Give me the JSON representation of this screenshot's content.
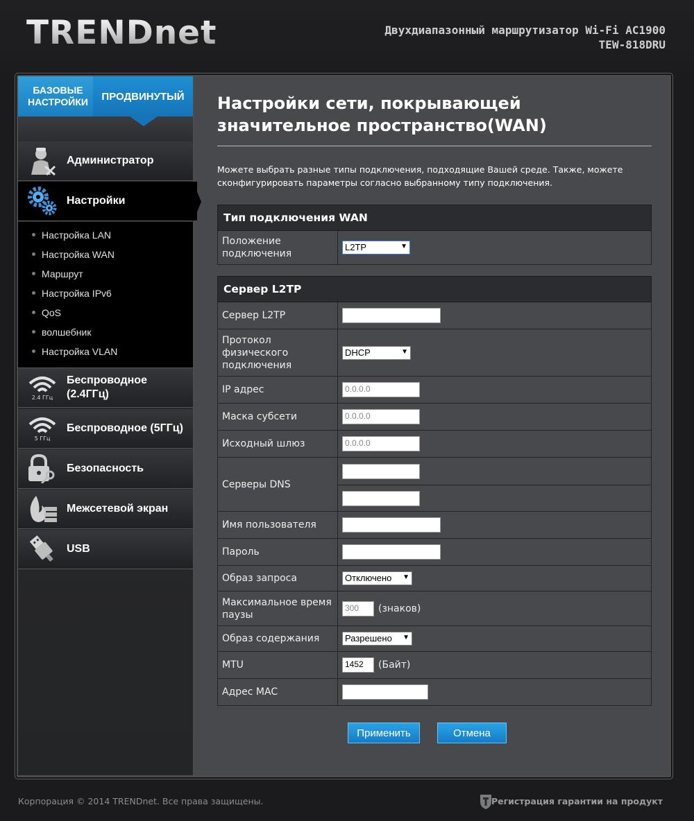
{
  "header": {
    "logo": "TRENDnet",
    "product_line1": "Двухдиапазонный маршрутизатор Wi-Fi AC1900",
    "product_line2": "TEW-818DRU"
  },
  "mode_tabs": {
    "basic": "БАЗОВЫЕ НАСТРОЙКИ",
    "advanced": "ПРОДВИНУТЫЙ",
    "active": "advanced"
  },
  "sidebar": {
    "items": [
      {
        "label": "Администратор",
        "icon": "admin-icon"
      },
      {
        "label": "Настройки",
        "icon": "gears-icon",
        "active": true
      },
      {
        "label": "Беспроводное (2.4ГГц)",
        "icon": "wifi-2-4-icon",
        "badge": "2.4 ГГц"
      },
      {
        "label": "Беспроводное (5ГГц)",
        "icon": "wifi-5-icon",
        "badge": "5 ГГц"
      },
      {
        "label": "Безопасность",
        "icon": "lock-icon"
      },
      {
        "label": "Межсетевой экран",
        "icon": "firewall-icon"
      },
      {
        "label": "USB",
        "icon": "usb-icon"
      }
    ],
    "submenu": [
      "Настройка LAN",
      "Настройка WAN",
      "Маршрут",
      "Настройка IPv6",
      "QoS",
      "волшебник",
      "Настройка VLAN"
    ]
  },
  "main": {
    "title": "Настройки сети, покрывающей значительное пространство(WAN)",
    "description": "Можете выбрать разные типы подключения, подходящие Вашей среде. Также, можете сконфигурировать параметры согласно выбранному типу подключения.",
    "wan_section": {
      "heading": "Тип подключения WAN",
      "connection_label": "Положение подключения",
      "connection_value": "L2TP"
    },
    "l2tp_section": {
      "heading": "Сервер L2TP",
      "server_label": "Сервер L2TP",
      "server_value": "",
      "phys_label": "Протокол физического подключения",
      "phys_value": "DHCP",
      "ip_label": "IP адрес",
      "ip_value": "0.0.0.0",
      "mask_label": "Маска субсети",
      "mask_value": "0.0.0.0",
      "gateway_label": "Исходный шлюз",
      "gateway_value": "0.0.0.0",
      "dns_label": "Серверы DNS",
      "dns1_value": "",
      "dns2_value": "",
      "user_label": "Имя пользователя",
      "user_value": "",
      "pass_label": "Пароль",
      "pass_value": "",
      "request_label": "Образ запроса",
      "request_value": "Отключено",
      "idle_label": "Максимальное время паузы",
      "idle_value": "300",
      "idle_unit": "(знаков)",
      "keepalive_label": "Образ содержания",
      "keepalive_value": "Разрешено",
      "mtu_label": "MTU",
      "mtu_value": "1452",
      "mtu_unit": "(Байт)",
      "mac_label": "Адрес MAC",
      "mac_value": ""
    },
    "apply_button": "Применить",
    "cancel_button": "Отмена"
  },
  "footer": {
    "copyright": "Корпорация © 2014 TRENDnet. Все права защищены.",
    "registration": "Регистрация гарантии на продукт"
  }
}
